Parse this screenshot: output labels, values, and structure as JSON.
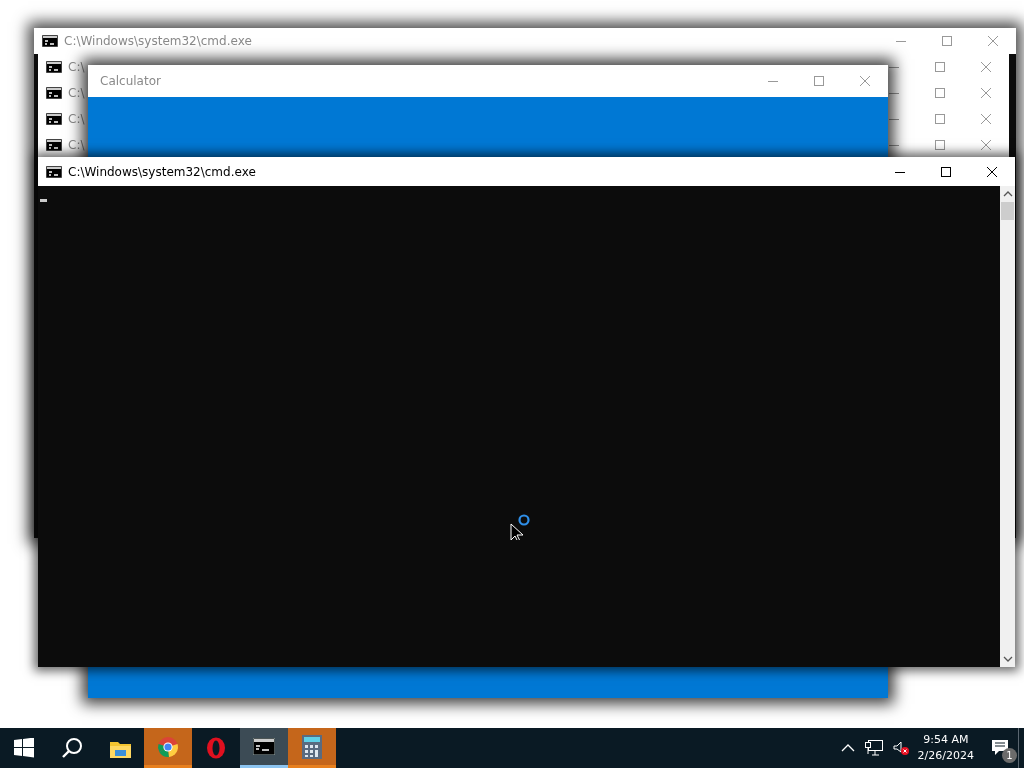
{
  "desktop_windows": [
    {
      "kind": "cmd",
      "title": "C:\\Windows\\system32\\cmd.exe",
      "active": false
    },
    {
      "kind": "cmd-stacked",
      "title": "C:\\",
      "active": false
    },
    {
      "kind": "cmd-stacked",
      "title": "C:\\",
      "active": false
    },
    {
      "kind": "cmd-stacked",
      "title": "C:\\",
      "active": false
    },
    {
      "kind": "cmd-stacked",
      "title": "C:\\",
      "active": false
    },
    {
      "kind": "calculator",
      "title": "Calculator",
      "active": false
    },
    {
      "kind": "console",
      "title": "C:\\Windows\\system32\\cmd.exe",
      "active": true
    }
  ],
  "taskbar": {
    "items": [
      {
        "kind": "start",
        "flashing": false,
        "selected": false
      },
      {
        "kind": "search",
        "flashing": false,
        "selected": false
      },
      {
        "kind": "explorer",
        "flashing": false,
        "selected": false
      },
      {
        "kind": "chrome",
        "flashing": true,
        "selected": false
      },
      {
        "kind": "opera",
        "flashing": false,
        "selected": false
      },
      {
        "kind": "cmd",
        "flashing": false,
        "selected": true
      },
      {
        "kind": "calculator",
        "flashing": true,
        "selected": false
      }
    ],
    "time": "9:54 AM",
    "date": "2/26/2024",
    "notifications": "1"
  }
}
